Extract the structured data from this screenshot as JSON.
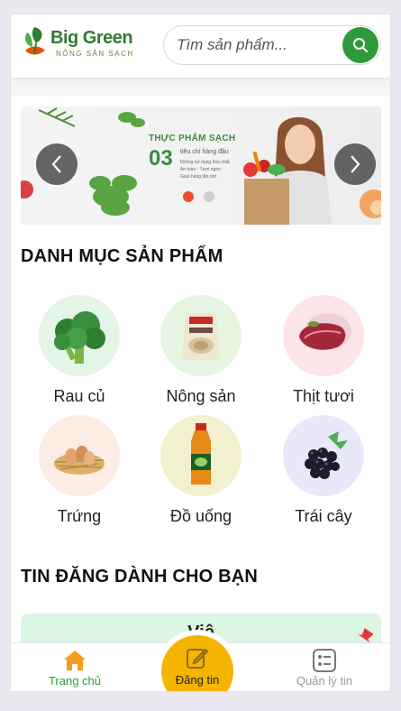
{
  "header": {
    "logo_text": "Big Green",
    "logo_subtitle": "NÔNG SẢN SẠCH",
    "search_placeholder": "Tìm sản phẩm..."
  },
  "banner": {
    "title": "THỰC PHẨM SẠCH",
    "number": "03",
    "subtitle": "tiêu chí hàng đầu",
    "bullets": [
      "Không sử dụng hóa chất",
      "An toàn - Tươi ngon",
      "Giao hàng tận nơi"
    ]
  },
  "categories": {
    "title": "DANH MỤC SẢN PHẨM",
    "items": [
      {
        "label": "Rau củ",
        "icon": "broccoli-icon"
      },
      {
        "label": "Nông sản",
        "icon": "rice-bag-icon"
      },
      {
        "label": "Thịt tươi",
        "icon": "meat-icon"
      },
      {
        "label": "Trứng",
        "icon": "egg-nest-icon"
      },
      {
        "label": "Đồ uống",
        "icon": "juice-bottle-icon"
      },
      {
        "label": "Trái cây",
        "icon": "blackberry-icon"
      }
    ]
  },
  "posts": {
    "title": "TIN ĐĂNG DÀNH CHO BẠN",
    "first_card_title": "Việ"
  },
  "nav": {
    "home": "Trang chủ",
    "post": "Đăng tin",
    "manage": "Quản lý tin"
  },
  "colors": {
    "brand_green": "#2e9b3b",
    "accent_yellow": "#f5b400",
    "post_card_bg": "#ddf5e3"
  }
}
